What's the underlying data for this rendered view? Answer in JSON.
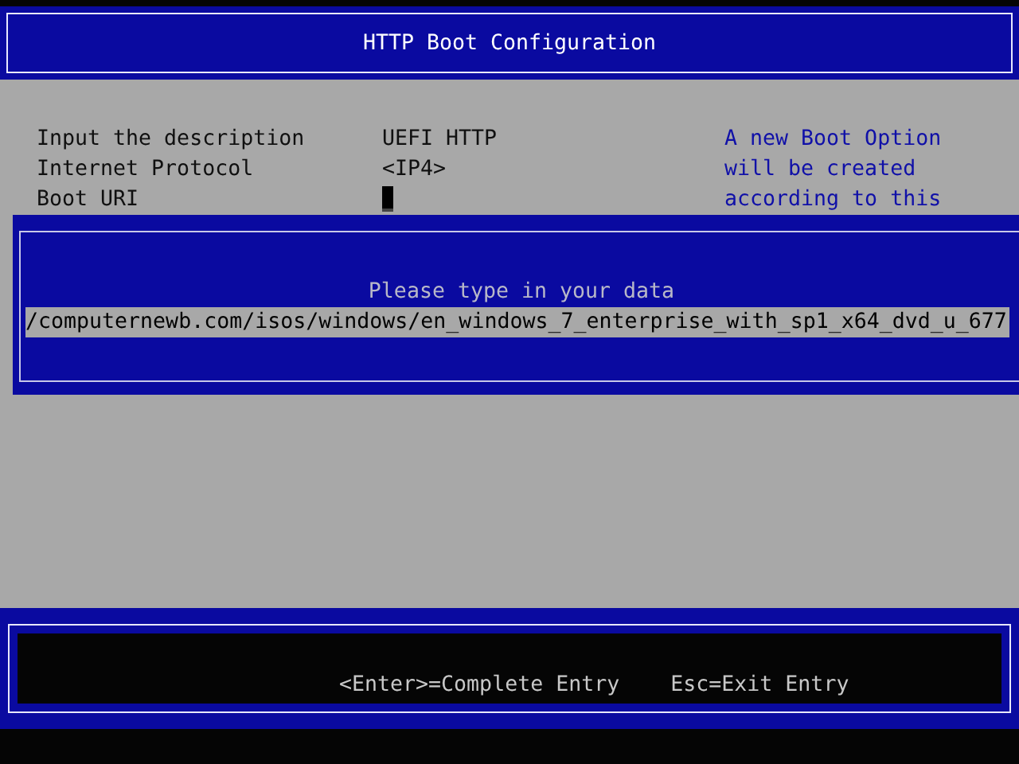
{
  "window": {
    "title": "HTTP Boot Configuration"
  },
  "fields": [
    {
      "label": "Input the description",
      "kind": "text",
      "value": "UEFI HTTP"
    },
    {
      "label": "Internet Protocol",
      "kind": "text",
      "value": "<IP4>"
    },
    {
      "label": "Boot URI",
      "kind": "cursor"
    }
  ],
  "help": [
    "A new Boot Option",
    "will be created",
    "according to this"
  ],
  "dialog": {
    "title": "Please type in your data",
    "value": "/computernewb.com/isos/windows/en_windows_7_enterprise_with_sp1_x64_dvd_u_677"
  },
  "status_bar": [
    "<Enter>=Complete Entry",
    "Esc=Exit Entry"
  ]
}
